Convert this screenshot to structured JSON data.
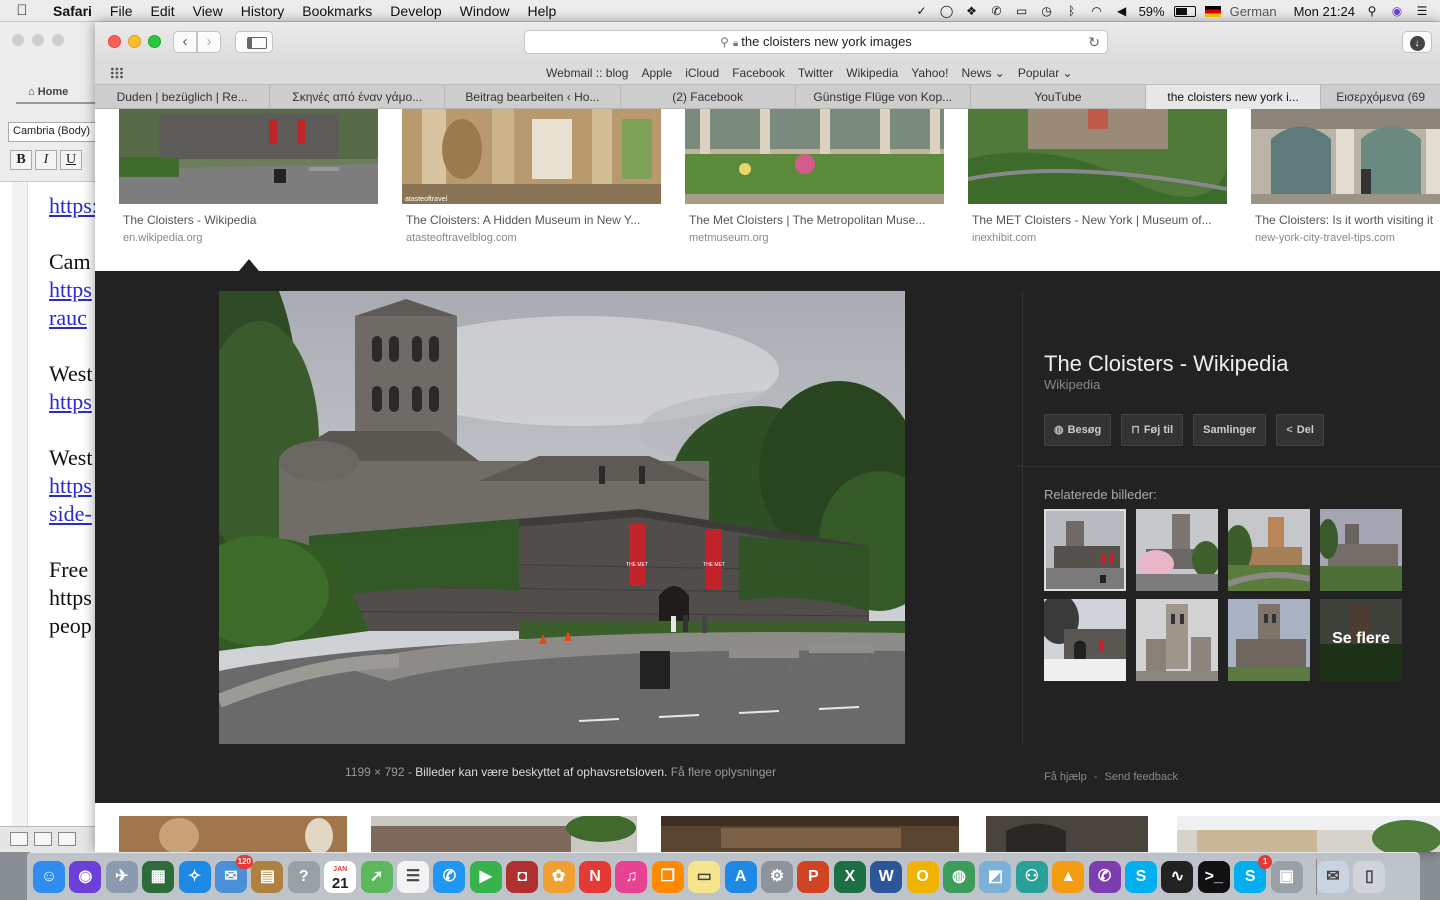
{
  "menubar": {
    "app": "Safari",
    "menus": [
      "File",
      "Edit",
      "View",
      "History",
      "Bookmarks",
      "Develop",
      "Window",
      "Help"
    ],
    "battery": "59%",
    "input_language": "German",
    "clock": "Mon 21:24"
  },
  "word": {
    "tab_home": "Home",
    "font_name": "Cambria (Body)",
    "format_buttons": [
      "B",
      "I",
      "U"
    ],
    "doc_lines": [
      {
        "text": "https:",
        "link": true
      },
      {
        "text": "Cam",
        "link": false
      },
      {
        "text": "https",
        "link": true
      },
      {
        "text": "rauc",
        "link": true
      },
      {
        "text": "West",
        "link": false
      },
      {
        "text": "https",
        "link": true
      },
      {
        "text": "West",
        "link": false
      },
      {
        "text": "https",
        "link": true
      },
      {
        "text": "side-",
        "link": true
      },
      {
        "text": "Free",
        "link": false
      },
      {
        "text": "https",
        "link": false
      },
      {
        "text": "peop",
        "link": false
      }
    ]
  },
  "safari": {
    "address": "the cloisters new york  images",
    "favorites": [
      "Webmail :: blog",
      "Apple",
      "iCloud",
      "Facebook",
      "Twitter",
      "Wikipedia",
      "Yahoo!",
      "News ⌄",
      "Popular ⌄"
    ],
    "tabs": [
      {
        "label": "Duden | bezüglich | Re...",
        "active": false
      },
      {
        "label": "Σκηνές από έναν γάμο...",
        "active": false
      },
      {
        "label": "Beitrag bearbeiten ‹ Ho...",
        "active": false
      },
      {
        "label": "(2) Facebook",
        "active": false
      },
      {
        "label": "Günstige Flüge von Kop...",
        "active": false
      },
      {
        "label": "YouTube",
        "active": false
      },
      {
        "label": "the cloisters new york i...",
        "active": true
      },
      {
        "label": "Εισερχόμενα (69",
        "active": false
      }
    ]
  },
  "results": [
    {
      "title": "The Cloisters - Wikipedia",
      "source": "en.wikipedia.org"
    },
    {
      "title": "The Cloisters: A Hidden Museum in New Y...",
      "source": "atasteoftravelblog.com"
    },
    {
      "title": "The Met Cloisters | The Metropolitan Muse...",
      "source": "metmuseum.org"
    },
    {
      "title": "The MET Cloisters - New York | Museum of...",
      "source": "inexhibit.com"
    },
    {
      "title": "The Cloisters: Is it worth visiting it",
      "source": "new-york-city-travel-tips.com"
    }
  ],
  "viewer": {
    "title": "The Cloisters - Wikipedia",
    "subtitle": "Wikipedia",
    "actions": [
      {
        "icon": "globe-icon",
        "glyph": "◍",
        "label": "Besøg"
      },
      {
        "icon": "bookmark-icon",
        "glyph": "⊓",
        "label": "Føj til"
      },
      {
        "icon": "",
        "glyph": "",
        "label": "Samlinger"
      },
      {
        "icon": "share-icon",
        "glyph": "<",
        "label": "Del"
      }
    ],
    "related_label": "Relaterede billeder:",
    "see_more": "Se flere",
    "dimensions": "1199 × 792",
    "separator": "-",
    "copyright": "Billeder kan være beskyttet af ophavsretsloven.",
    "more_info": "Få flere oplysninger",
    "help": "Få hjælp",
    "feedback": "Send feedback"
  },
  "banner_text": [
    "THE MET",
    "THE MET"
  ],
  "watermark": "atasteoftravel",
  "dock": {
    "calendar_month": "JAN",
    "calendar_day": "21",
    "mail_badge": "120",
    "skype_badge": "1",
    "apps": [
      {
        "name": "finder-icon",
        "glyph": "☺",
        "color": "#2f8cf0"
      },
      {
        "name": "siri-icon",
        "glyph": "◉",
        "color": "#6b3fd8"
      },
      {
        "name": "launchpad-icon",
        "glyph": "✈",
        "color": "#8a9bb0"
      },
      {
        "name": "mission-control-icon",
        "glyph": "▦",
        "color": "#2d6b3a"
      },
      {
        "name": "safari-icon",
        "glyph": "✧",
        "color": "#1e88e5"
      },
      {
        "name": "mail-icon",
        "glyph": "✉",
        "color": "#4a90d9"
      },
      {
        "name": "notes-app-icon",
        "glyph": "▤",
        "color": "#b08040"
      },
      {
        "name": "help-icon",
        "glyph": "?",
        "color": "#9aa0a8"
      },
      {
        "name": "calendar-icon",
        "glyph": "",
        "color": "#ffffff"
      },
      {
        "name": "maps-icon",
        "glyph": "➚",
        "color": "#5cb85c"
      },
      {
        "name": "reminders-icon",
        "glyph": "☰",
        "color": "#f3f3f3"
      },
      {
        "name": "messages-icon",
        "glyph": "✆",
        "color": "#2196f3"
      },
      {
        "name": "facetime-icon",
        "glyph": "▶",
        "color": "#37b24d"
      },
      {
        "name": "photo-booth-icon",
        "glyph": "◘",
        "color": "#b03030"
      },
      {
        "name": "photos-icon",
        "glyph": "✿",
        "color": "#f0a030"
      },
      {
        "name": "news-icon",
        "glyph": "N",
        "color": "#e53935"
      },
      {
        "name": "music-icon",
        "glyph": "♫",
        "color": "#e84393"
      },
      {
        "name": "books-icon",
        "glyph": "❒",
        "color": "#ff8a00"
      },
      {
        "name": "stickies-icon",
        "glyph": "▭",
        "color": "#f6e58d"
      },
      {
        "name": "app-store-icon",
        "glyph": "A",
        "color": "#1e88e5"
      },
      {
        "name": "system-preferences-icon",
        "glyph": "⚙",
        "color": "#8d949c"
      },
      {
        "name": "powerpoint-icon",
        "glyph": "P",
        "color": "#d04423"
      },
      {
        "name": "excel-icon",
        "glyph": "X",
        "color": "#1d7044"
      },
      {
        "name": "word-icon",
        "glyph": "W",
        "color": "#2b579a"
      },
      {
        "name": "outlook-icon",
        "glyph": "O",
        "color": "#f0b400"
      },
      {
        "name": "globe-app-icon",
        "glyph": "◍",
        "color": "#3c9d5a"
      },
      {
        "name": "preview-icon",
        "glyph": "◩",
        "color": "#7bb0d8"
      },
      {
        "name": "network-icon",
        "glyph": "⚇",
        "color": "#2aa198"
      },
      {
        "name": "vlc-icon",
        "glyph": "▲",
        "color": "#f39c12"
      },
      {
        "name": "viber-icon",
        "glyph": "✆",
        "color": "#7d3daf"
      },
      {
        "name": "skype-icon",
        "glyph": "S",
        "color": "#00aff0"
      },
      {
        "name": "activity-monitor-icon",
        "glyph": "∿",
        "color": "#222222"
      },
      {
        "name": "terminal-icon",
        "glyph": ">_",
        "color": "#111111"
      },
      {
        "name": "skype-alt-icon",
        "glyph": "S",
        "color": "#00aff0"
      },
      {
        "name": "image-capture-icon",
        "glyph": "▣",
        "color": "#9aa0a8"
      },
      {
        "name": "downloads-icon",
        "glyph": "✉",
        "color": "#c8d4e0"
      },
      {
        "name": "trash-icon",
        "glyph": "▯",
        "color": "#cfd4da"
      }
    ]
  }
}
